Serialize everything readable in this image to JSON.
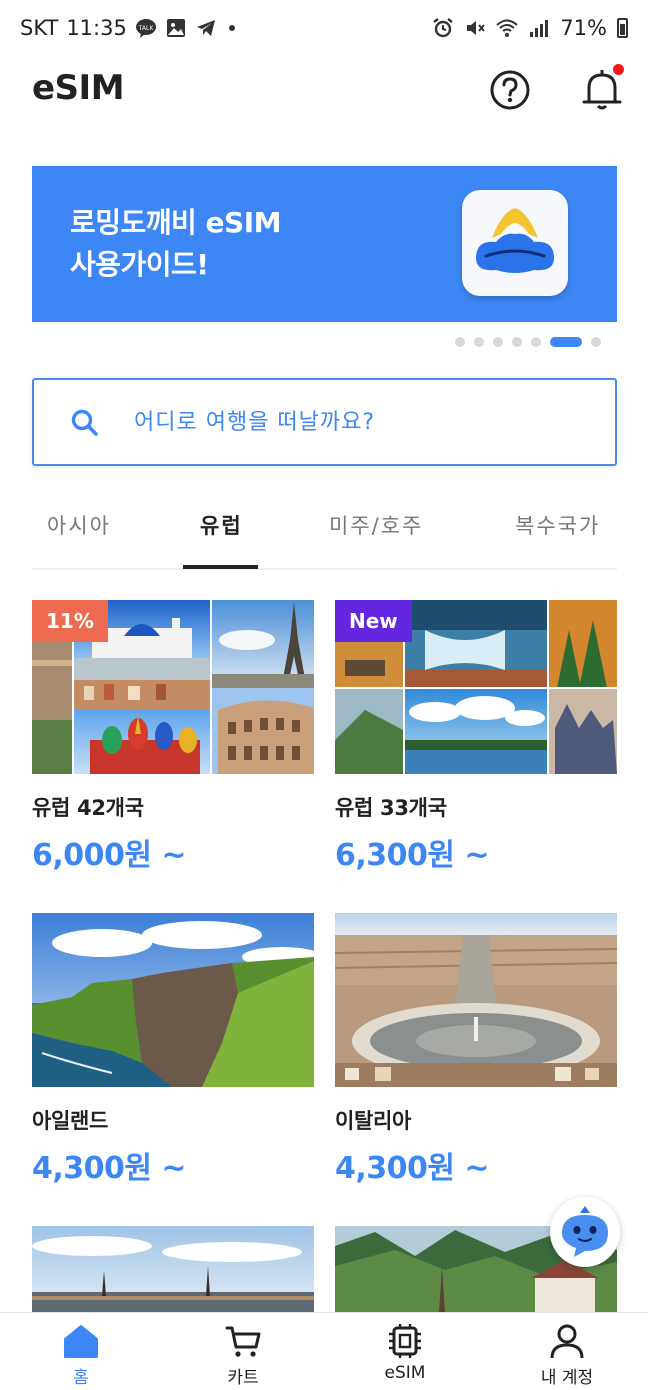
{
  "status_bar": {
    "carrier": "SKT",
    "time": "11:35",
    "battery_percent": "71%",
    "left_icons": [
      "kakaotalk-icon",
      "gallery-icon",
      "telegram-icon"
    ],
    "right_icons": [
      "alarm-icon",
      "mute-icon",
      "wifi-icon",
      "signal-icon",
      "battery-icon"
    ]
  },
  "header": {
    "title": "eSIM",
    "help_icon": "question-circle-icon",
    "notification_icon": "bell-icon",
    "has_unread": true
  },
  "banner": {
    "line1": "로밍도깨비 eSIM",
    "line2": "사용가이드!",
    "background": "#3d86f5",
    "page_count": 8,
    "active_page": 7
  },
  "search": {
    "placeholder": "어디로 여행을 떠날까요?"
  },
  "tabs": [
    {
      "label": "아시아",
      "active": false
    },
    {
      "label": "유럽",
      "active": true
    },
    {
      "label": "미주/호주",
      "active": false
    },
    {
      "label": "복수국가",
      "active": false
    }
  ],
  "products": [
    {
      "title": "유럽 42개국",
      "price": "6,000원 ~",
      "badge": "11%"
    },
    {
      "title": "유럽 33개국",
      "price": "6,300원 ~",
      "badge": "New"
    },
    {
      "title": "아일랜드",
      "price": "4,300원 ~",
      "badge": ""
    },
    {
      "title": "이탈리아",
      "price": "4,300원 ~",
      "badge": ""
    }
  ],
  "bottom_nav": [
    {
      "label": "홈",
      "icon": "home-icon",
      "active": true
    },
    {
      "label": "카트",
      "icon": "cart-icon",
      "active": false
    },
    {
      "label": "eSIM",
      "icon": "chip-icon",
      "active": false
    },
    {
      "label": "내 계정",
      "icon": "user-icon",
      "active": false
    }
  ],
  "colors": {
    "accent": "#3d86f5",
    "discount_badge": "#ee6a50",
    "new_badge": "#6427e0",
    "notification_dot": "#f01a1a"
  }
}
